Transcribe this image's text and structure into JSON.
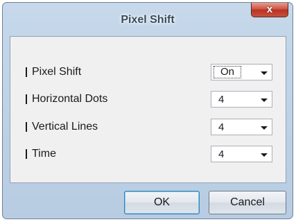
{
  "window": {
    "title": "Pixel Shift",
    "close_label": "x"
  },
  "settings": [
    {
      "label": "Pixel Shift",
      "value": "On"
    },
    {
      "label": "Horizontal Dots",
      "value": "4"
    },
    {
      "label": "Vertical Lines",
      "value": "4"
    },
    {
      "label": "Time",
      "value": "4"
    }
  ],
  "buttons": {
    "ok_label": "OK",
    "cancel_label": "Cancel"
  },
  "colors": {
    "frame": "#b7cce2",
    "close_button": "#c9503c",
    "panel": "#f0f0f0"
  }
}
